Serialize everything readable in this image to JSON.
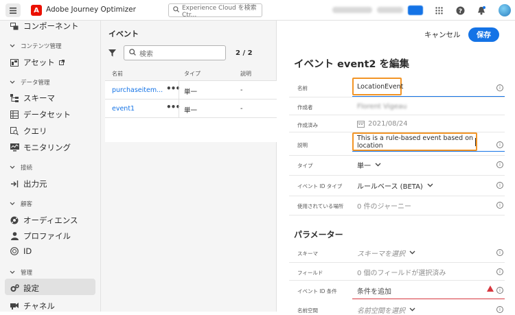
{
  "app": {
    "title": "Adobe Journey Optimizer",
    "logo_letter": "A"
  },
  "topbar": {
    "search_placeholder": "Experience Cloud を検索 Ctr..."
  },
  "sidebar": {
    "items": [
      {
        "label": "コンポーネント",
        "icon": "components-icon"
      },
      {
        "label": "コンテンツ管理",
        "type": "section"
      },
      {
        "label": "アセット",
        "icon": "assets-icon"
      },
      {
        "label": "データ管理",
        "type": "section"
      },
      {
        "label": "スキーマ",
        "icon": "schema-icon"
      },
      {
        "label": "データセット",
        "icon": "dataset-icon"
      },
      {
        "label": "クエリ",
        "icon": "query-icon"
      },
      {
        "label": "モニタリング",
        "icon": "monitoring-icon"
      },
      {
        "label": "接続",
        "type": "section"
      },
      {
        "label": "出力元",
        "icon": "sources-icon"
      },
      {
        "label": "顧客",
        "type": "section"
      },
      {
        "label": "オーディエンス",
        "icon": "audience-icon"
      },
      {
        "label": "プロファイル",
        "icon": "profile-icon"
      },
      {
        "label": "ID",
        "icon": "identity-icon"
      },
      {
        "label": "管理",
        "type": "section"
      },
      {
        "label": "設定",
        "icon": "settings-icon"
      },
      {
        "label": "チャネル",
        "icon": "channel-icon"
      }
    ]
  },
  "events": {
    "title": "イベント",
    "search_placeholder": "検索",
    "count": "2 / 2",
    "columns": [
      "名前",
      "タイプ",
      "説明"
    ],
    "rows": [
      {
        "name": "purchaseitem...",
        "type": "単一",
        "desc": "-"
      },
      {
        "name": "event1",
        "type": "単一",
        "desc": "-"
      }
    ]
  },
  "editor": {
    "cancel": "キャンセル",
    "save": "保存",
    "title": "イベント event2 を編集",
    "fields": {
      "name_label": "名前",
      "name_value": "LocationEvent",
      "author_label": "作成者",
      "author_value": "Florent Vigeau",
      "created_label": "作成済み",
      "created_value": "2021/08/24",
      "desc_label": "説明",
      "desc_value": "This is a rule-based event based on location",
      "type_label": "タイプ",
      "type_value": "単一",
      "idtype_label": "イベント ID タイプ",
      "idtype_value": "ルールベース (BETA)",
      "used_label": "使用されている場所",
      "used_value": "0 件のジャーニー"
    },
    "params_title": "パラメーター",
    "params": {
      "schema_label": "スキーマ",
      "schema_value": "スキーマを選択",
      "field_label": "フィールド",
      "field_value": "0 個のフィールドが選択済み",
      "cond_label": "イベント ID 条件",
      "cond_value": "条件を追加",
      "ns_label": "名前空間",
      "ns_value": "名前空間を選択"
    }
  }
}
